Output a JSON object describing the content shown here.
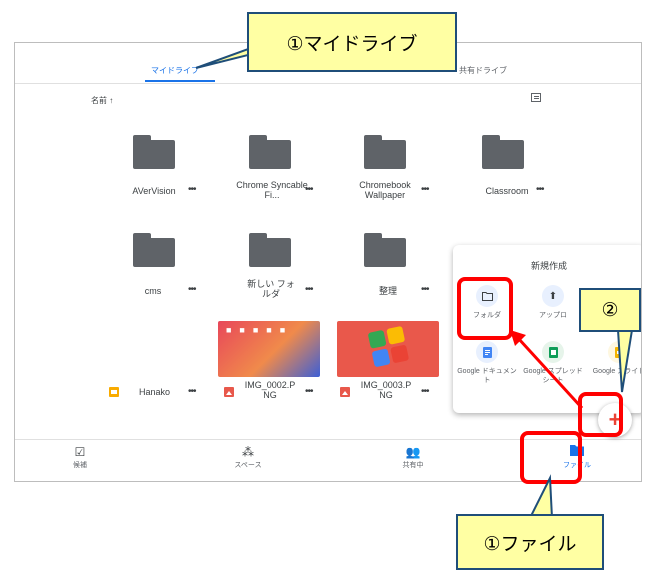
{
  "tabs": {
    "my_drive": "マイドライブ",
    "shared_drives": "共有ドライブ"
  },
  "sort_label": "名前 ↑",
  "view_icon": "list-view-icon",
  "files": [
    {
      "name": "AVerVision",
      "type": "folder"
    },
    {
      "name": "Chrome Syncable Fi...",
      "type": "folder"
    },
    {
      "name": "Chromebook Wallpaper",
      "type": "folder"
    },
    {
      "name": "Classroom",
      "type": "folder"
    },
    {
      "name": "cms",
      "type": "folder"
    },
    {
      "name": "新しい フォルダ",
      "type": "folder"
    },
    {
      "name": "整理",
      "type": "folder"
    },
    {
      "name": "Hanako",
      "type": "slides"
    },
    {
      "name": "IMG_0002.P NG",
      "type": "image"
    },
    {
      "name": "IMG_0003.P NG",
      "type": "image"
    }
  ],
  "more_label": "•••",
  "new_menu": {
    "title": "新規作成",
    "items": [
      {
        "label": "フォルダ",
        "icon": "folder-icon"
      },
      {
        "label": "アップロ",
        "icon": "upload-icon"
      },
      {
        "label": "Google ドキュメント",
        "icon": "docs-icon"
      },
      {
        "label": "Google スプレッドシート",
        "icon": "sheets-icon"
      },
      {
        "label": "Google スライド",
        "icon": "slides-icon"
      }
    ]
  },
  "fab_label": "+",
  "bottom_nav": [
    {
      "label": "候補",
      "icon": "check-circle-icon"
    },
    {
      "label": "スペース",
      "icon": "workspaces-icon"
    },
    {
      "label": "共有中",
      "icon": "people-icon"
    },
    {
      "label": "ファイル",
      "icon": "folder-icon",
      "active": true
    }
  ],
  "callouts": {
    "my_drive": "①マイドライブ",
    "new_button": "②",
    "files": "①ファイル"
  },
  "colors": {
    "accent": "#1a73e8",
    "highlight": "#ff0000",
    "callout_bg": "#ffffa3"
  }
}
